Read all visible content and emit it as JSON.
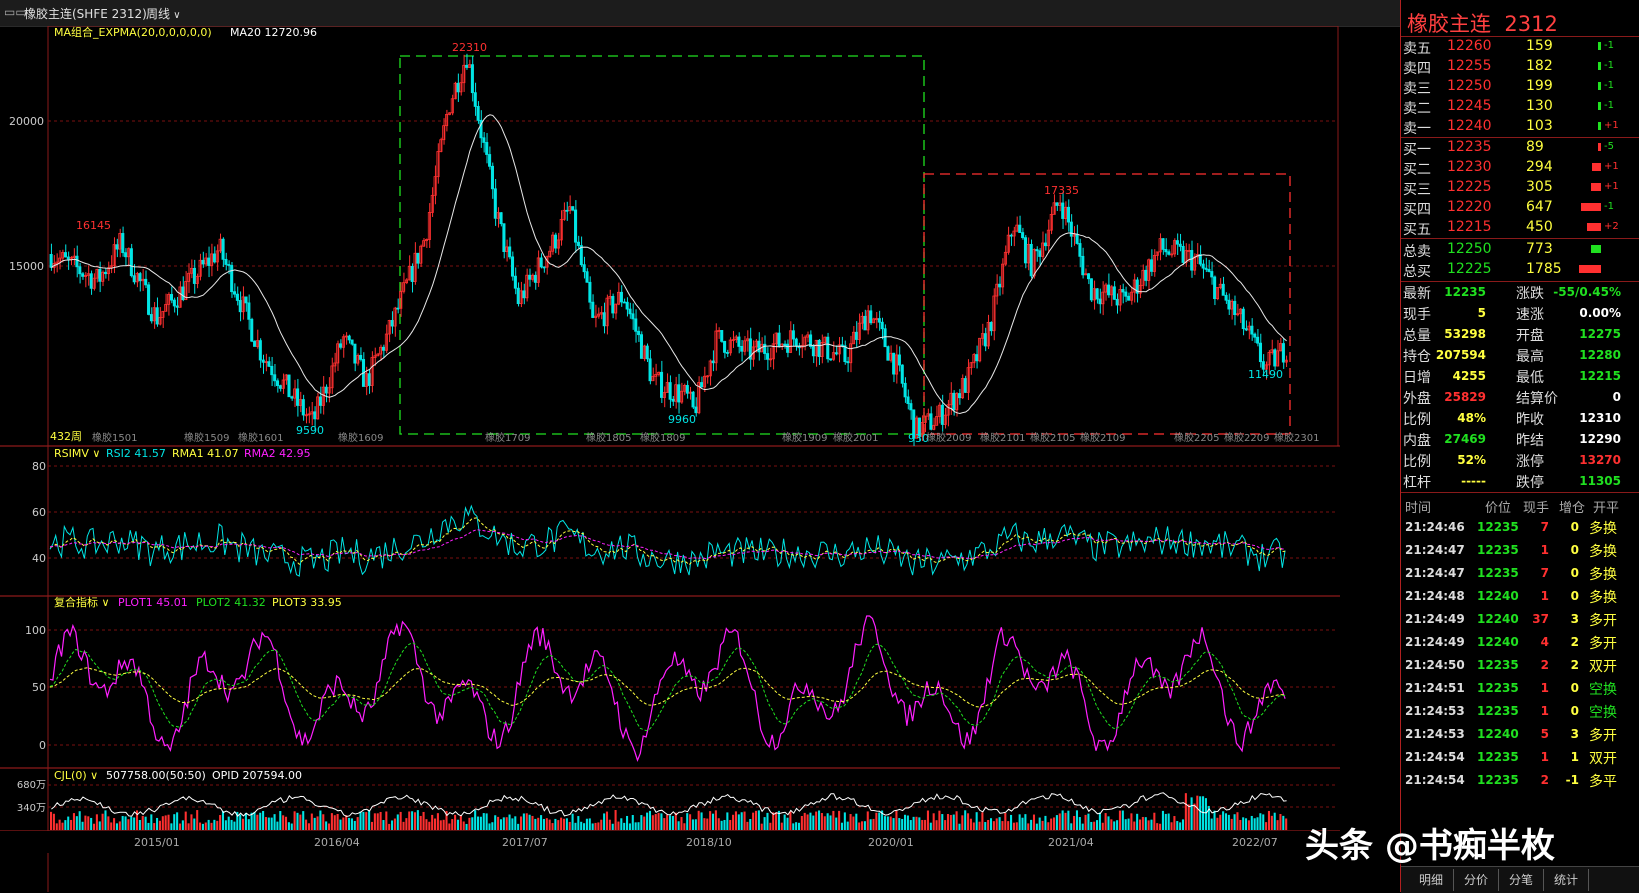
{
  "topbar": {
    "menu_icon": "window-icon",
    "title": "橡胶主连(SHFE 2312)",
    "period": "周线"
  },
  "main_panel": {
    "indicator_name": "MA组合_EXPMA(20,0,0,0,0,0)",
    "indicator_value": "MA20 12720.96",
    "y_ticks": [
      "20000",
      "15000"
    ],
    "corner_label": "432周",
    "annotations": {
      "high1": "16145",
      "high2": "22310",
      "high3": "17335",
      "low1": "9590",
      "low2": "9960",
      "low3": "930",
      "low4": "11490"
    },
    "contracts": [
      "橡胶1501",
      "橡胶1509",
      "橡胶1601",
      "橡胶1609",
      "橡胶1709",
      "橡胶1805",
      "橡胶1809",
      "橡胶1909",
      "橡胶2001",
      "橡胶2009",
      "橡胶2101",
      "橡胶2105",
      "橡胶2109",
      "橡胶2205",
      "橡胶2209",
      "橡胶2301"
    ]
  },
  "rsi_panel": {
    "name": "RSIMV",
    "rsi2": "RSI2 41.57",
    "rma1": "RMA1 41.07",
    "rma2": "RMA2 42.95",
    "y_ticks": [
      "80",
      "60",
      "40"
    ]
  },
  "composite_panel": {
    "name": "复合指标",
    "plot1": "PLOT1 45.01",
    "plot2": "PLOT2 41.32",
    "plot3": "PLOT3 33.95",
    "y_ticks": [
      "100",
      "50",
      "0"
    ]
  },
  "volume_panel": {
    "name": "CJL(0)",
    "value1": "507758.00(50:50)",
    "value2": "OPID 207594.00",
    "y_ticks": [
      "680万",
      "340万"
    ]
  },
  "x_axis_dates": [
    "2015/01",
    "2016/04",
    "2017/07",
    "2018/10",
    "2020/01",
    "2021/04",
    "2022/07"
  ],
  "quote": {
    "title": "橡胶主连",
    "code": "2312",
    "asks": [
      {
        "label": "卖五",
        "price": "12260",
        "vol": "159",
        "chg": "-1"
      },
      {
        "label": "卖四",
        "price": "12255",
        "vol": "182",
        "chg": "-1"
      },
      {
        "label": "卖三",
        "price": "12250",
        "vol": "199",
        "chg": "-1"
      },
      {
        "label": "卖二",
        "price": "12245",
        "vol": "130",
        "chg": "-1"
      },
      {
        "label": "卖一",
        "price": "12240",
        "vol": "103",
        "chg": "+1"
      }
    ],
    "bids": [
      {
        "label": "买一",
        "price": "12235",
        "vol": "89",
        "chg": "-5"
      },
      {
        "label": "买二",
        "price": "12230",
        "vol": "294",
        "chg": "+1"
      },
      {
        "label": "买三",
        "price": "12225",
        "vol": "305",
        "chg": "+1"
      },
      {
        "label": "买四",
        "price": "12220",
        "vol": "647",
        "chg": "-1"
      },
      {
        "label": "买五",
        "price": "12215",
        "vol": "450",
        "chg": "+2"
      }
    ],
    "totals": [
      {
        "label": "总卖",
        "price": "12250",
        "vol": "773"
      },
      {
        "label": "总买",
        "price": "12225",
        "vol": "1785"
      }
    ],
    "stats": [
      {
        "l1": "最新",
        "v1": "12235",
        "l2": "涨跌",
        "v2": "-55/0.45%"
      },
      {
        "l1": "现手",
        "v1": "5",
        "l2": "速涨",
        "v2": "0.00%"
      },
      {
        "l1": "总量",
        "v1": "53298",
        "l2": "开盘",
        "v2": "12275"
      },
      {
        "l1": "持仓",
        "v1": "207594",
        "l2": "最高",
        "v2": "12280"
      },
      {
        "l1": "日增",
        "v1": "4255",
        "l2": "最低",
        "v2": "12215"
      },
      {
        "l1": "外盘",
        "v1": "25829",
        "l2": "结算价",
        "v2": "0"
      },
      {
        "l1": "比例",
        "v1": "48%",
        "l2": "昨收",
        "v2": "12310"
      },
      {
        "l1": "内盘",
        "v1": "27469",
        "l2": "昨结",
        "v2": "12290"
      },
      {
        "l1": "比例",
        "v1": "52%",
        "l2": "涨停",
        "v2": "13270"
      },
      {
        "l1": "杠杆",
        "v1": "-----",
        "l2": "跌停",
        "v2": "11305"
      }
    ],
    "tick_header": [
      "时间",
      "价位",
      "现手",
      "增仓",
      "开平"
    ],
    "ticks": [
      {
        "t": "21:24:46",
        "p": "12235",
        "v": "7",
        "oi": "0",
        "type": "多换"
      },
      {
        "t": "21:24:47",
        "p": "12235",
        "v": "1",
        "oi": "0",
        "type": "多换"
      },
      {
        "t": "21:24:47",
        "p": "12235",
        "v": "7",
        "oi": "0",
        "type": "多换"
      },
      {
        "t": "21:24:48",
        "p": "12240",
        "v": "1",
        "oi": "0",
        "type": "多换"
      },
      {
        "t": "21:24:49",
        "p": "12240",
        "v": "37",
        "oi": "3",
        "type": "多开"
      },
      {
        "t": "21:24:49",
        "p": "12240",
        "v": "4",
        "oi": "2",
        "type": "多开"
      },
      {
        "t": "21:24:50",
        "p": "12235",
        "v": "2",
        "oi": "2",
        "type": "双开"
      },
      {
        "t": "21:24:51",
        "p": "12235",
        "v": "1",
        "oi": "0",
        "type": "空换"
      },
      {
        "t": "21:24:53",
        "p": "12235",
        "v": "1",
        "oi": "0",
        "type": "空换"
      },
      {
        "t": "21:24:53",
        "p": "12240",
        "v": "5",
        "oi": "3",
        "type": "多开"
      },
      {
        "t": "21:24:54",
        "p": "12235",
        "v": "1",
        "oi": "1",
        "type": "双开"
      },
      {
        "t": "21:24:54",
        "p": "12235",
        "v": "2",
        "oi": "-1",
        "type": "多平"
      }
    ],
    "tabs": [
      "明细",
      "分价",
      "分笔",
      "统计"
    ]
  },
  "watermark": "头条 @书痴半枚",
  "colors": {
    "up": "#ff3030",
    "down": "#00e5e5",
    "green": "#20e020",
    "yellow": "#ffff40",
    "magenta": "#ff20ff",
    "white": "#ffffff",
    "border": "#b02020"
  }
}
